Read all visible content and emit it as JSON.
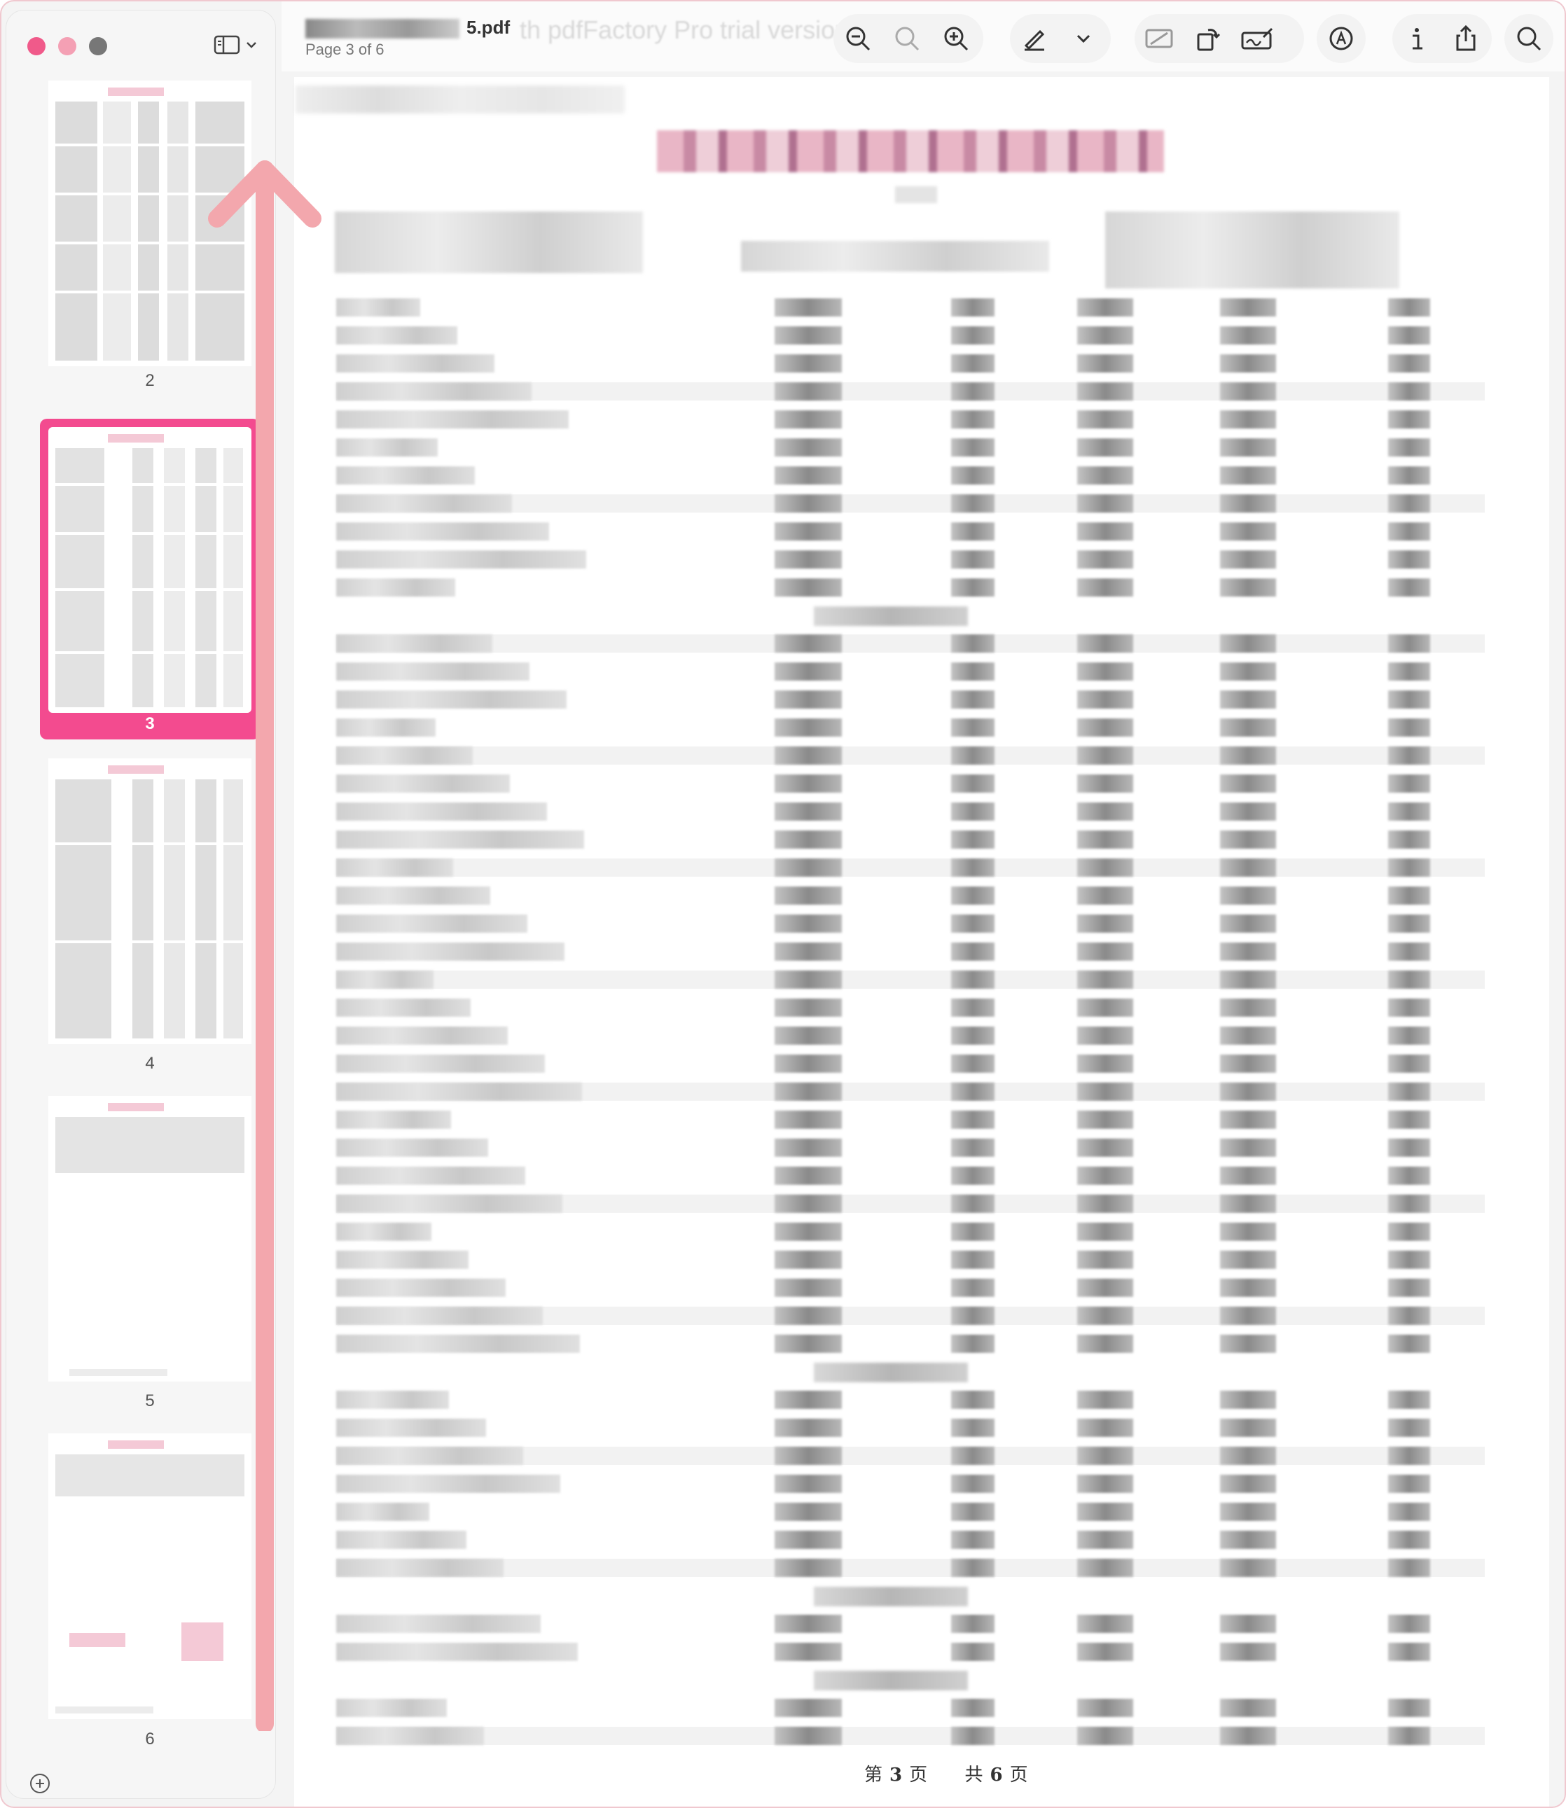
{
  "window": {
    "file_name_suffix": "5.pdf",
    "page_indicator": "Page 3 of 6",
    "watermark": "th pdfFactory Pro trial version"
  },
  "sidebar": {
    "thumbnails": [
      {
        "label": "2"
      },
      {
        "label": "3",
        "selected": true
      },
      {
        "label": "4"
      },
      {
        "label": "5"
      },
      {
        "label": "6"
      }
    ]
  },
  "toolbar": {
    "buttons": [
      "zoom-out-icon",
      "actual-size-icon",
      "zoom-in-icon",
      "highlight-pen-icon",
      "chevron-down-icon",
      "crop-icon",
      "rotate-icon",
      "signature-icon",
      "markup-icon",
      "info-icon",
      "share-icon",
      "search-icon"
    ]
  },
  "document": {
    "footer": {
      "prefix": "第",
      "current": "3",
      "mid": "页",
      "total_prefix": "共",
      "total": "6",
      "suffix": "页"
    }
  },
  "colors": {
    "accent": "#f34b8f",
    "arrow": "#f3a7ad",
    "close": "#f05a8a"
  }
}
